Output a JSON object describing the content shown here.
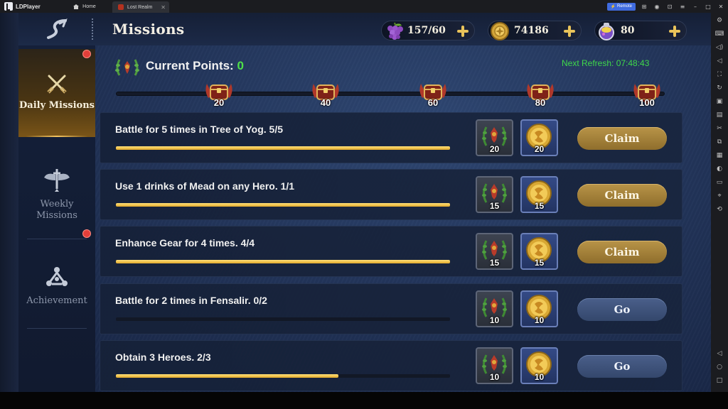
{
  "emulator": {
    "brand": "LDPlayer",
    "tabs": [
      {
        "label": "Home"
      },
      {
        "label": "Lost Realm"
      }
    ],
    "remote_label": "Remote"
  },
  "header": {
    "title": "Missions",
    "resources": [
      {
        "icon": "grapes-icon",
        "value": "157/60"
      },
      {
        "icon": "gold-coin-icon",
        "value": "74186"
      },
      {
        "icon": "potion-icon",
        "value": "80"
      }
    ]
  },
  "nav": {
    "items": [
      {
        "label": "Daily Missions",
        "active": true,
        "badge": true
      },
      {
        "label": "Weekly Missions",
        "active": false,
        "badge": false
      },
      {
        "label": "Achievement",
        "active": false,
        "badge": true
      }
    ]
  },
  "points": {
    "label": "Current Points: ",
    "value": "0",
    "refresh": "Next Refresh: 07:48:43",
    "progress": 0,
    "milestones": [
      "20",
      "40",
      "60",
      "80",
      "100"
    ]
  },
  "missions": [
    {
      "text": "Battle for 5 times in Tree of Yog.  5/5",
      "progress": 1.0,
      "reward_points": "20",
      "reward_coins": "20",
      "action": "Claim"
    },
    {
      "text": "Use 1 drinks of Mead on any Hero.  1/1",
      "progress": 1.0,
      "reward_points": "15",
      "reward_coins": "15",
      "action": "Claim"
    },
    {
      "text": "Enhance Gear for 4 times.  4/4",
      "progress": 1.0,
      "reward_points": "15",
      "reward_coins": "15",
      "action": "Claim"
    },
    {
      "text": "Battle for 2 times in Fensalir.  0/2",
      "progress": 0.0,
      "reward_points": "10",
      "reward_coins": "10",
      "action": "Go"
    },
    {
      "text": "Obtain 3 Heroes.  2/3",
      "progress": 0.667,
      "reward_points": "10",
      "reward_coins": "10",
      "action": "Go"
    }
  ],
  "colors": {
    "accent_green": "#4fe048",
    "claim_button": "#b89448",
    "go_button": "#4a5f8a",
    "progress_fill": "#f0c44a"
  }
}
